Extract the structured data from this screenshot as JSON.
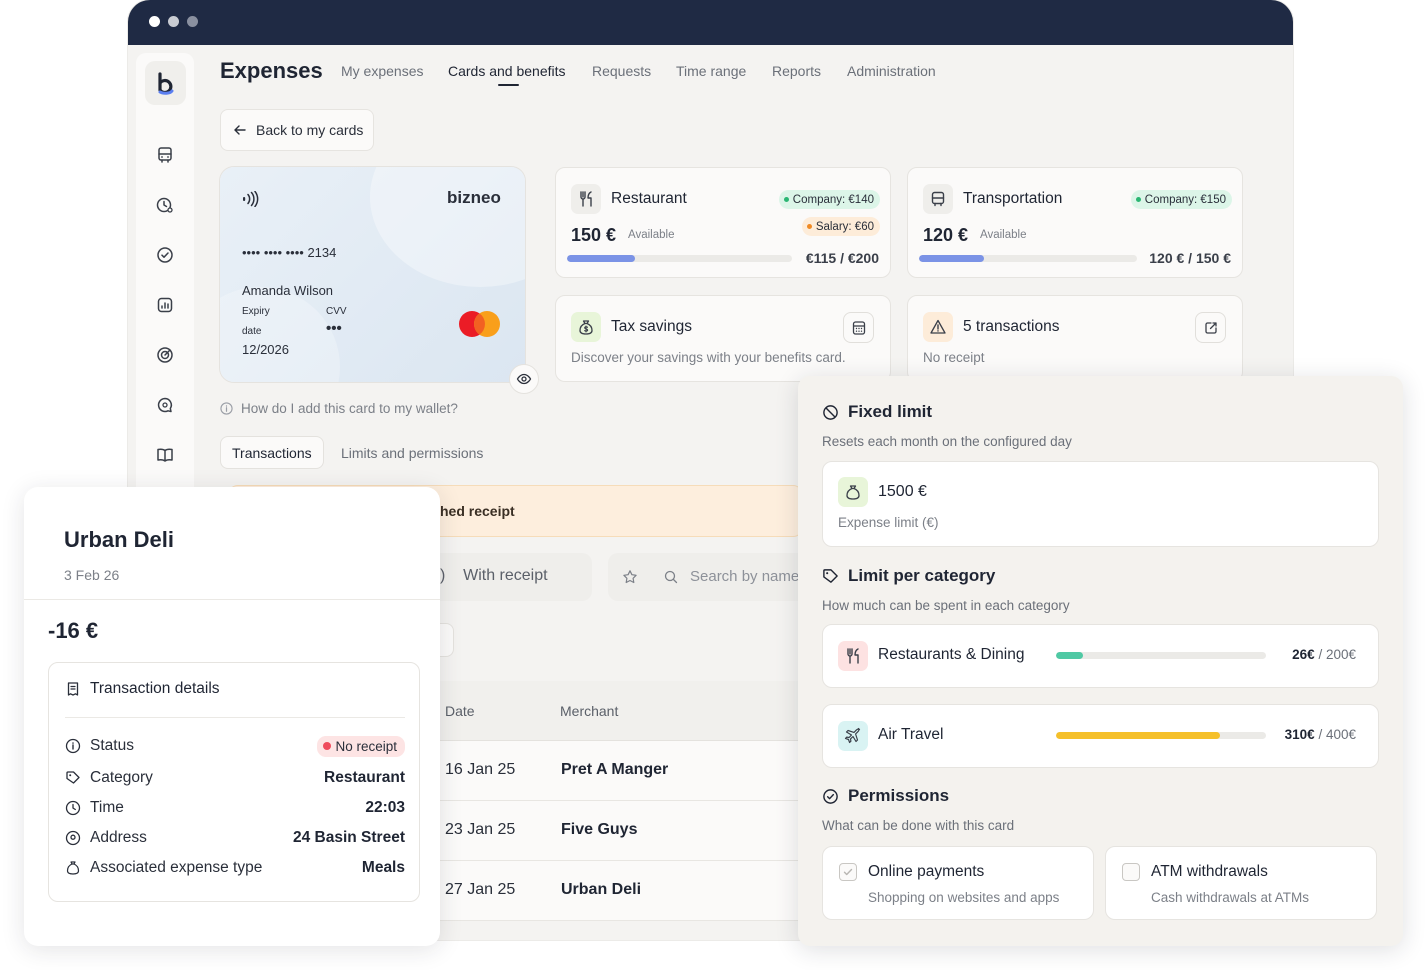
{
  "app": {
    "title": "Expenses",
    "nav_tabs": [
      {
        "label": "My expenses",
        "active": false
      },
      {
        "label": "Cards and benefits",
        "active": true
      },
      {
        "label": "Requests",
        "active": false
      },
      {
        "label": "Time range",
        "active": false
      },
      {
        "label": "Reports",
        "active": false
      },
      {
        "label": "Administration",
        "active": false
      }
    ],
    "back_label": "Back to my cards"
  },
  "card": {
    "brand": "bizneo",
    "number": "•••• •••• •••• 2134",
    "holder": "Amanda Wilson",
    "expiry_label": "Expiry",
    "expiry_label2": "date",
    "expiry_value": "12/2026",
    "cvv_label": "CVV",
    "cvv_value": "•••",
    "wallet_hint": "How do I add this card to my wallet?"
  },
  "sub_tabs": [
    {
      "label": "Transactions",
      "active": true
    },
    {
      "label": "Limits and permissions",
      "active": false
    }
  ],
  "benefits": {
    "restaurant": {
      "title": "Restaurant",
      "badge_company": "Company: €140",
      "badge_salary": "Salary: €60",
      "amount": "150 €",
      "available_label": "Available",
      "ratio": "€115 / €200",
      "progress": 0.3
    },
    "transportation": {
      "title": "Transportation",
      "badge_company": "Company: €150",
      "amount": "120 €",
      "available_label": "Available",
      "ratio": "120 € / 150 €",
      "progress": 0.3
    },
    "tax": {
      "title": "Tax savings",
      "desc": "Discover your savings with your benefits card."
    },
    "transactions": {
      "title": "5 transactions",
      "desc": "No receipt"
    }
  },
  "background": {
    "banner_text": "hed receipt",
    "filter_label": ")    With receipt",
    "search_placeholder": "Search by name",
    "table": {
      "headers": [
        "Date",
        "Merchant"
      ],
      "rows": [
        {
          "date": "16 Jan 25",
          "merchant": "Pret A Manger"
        },
        {
          "date": "23 Jan 25",
          "merchant": "Five Guys"
        },
        {
          "date": "27 Jan 25",
          "merchant": "Urban Deli"
        }
      ]
    }
  },
  "detail": {
    "merchant": "Urban Deli",
    "date": "3 Feb 26",
    "amount": "-16 €",
    "section_title": "Transaction details",
    "rows": {
      "status": {
        "label": "Status",
        "value": "No receipt"
      },
      "category": {
        "label": "Category",
        "value": "Restaurant"
      },
      "time": {
        "label": "Time",
        "value": "22:03"
      },
      "address": {
        "label": "Address",
        "value": "24 Basin Street"
      },
      "expense_type": {
        "label": "Associated expense type",
        "value": "Meals"
      }
    }
  },
  "limits": {
    "fixed": {
      "title": "Fixed limit",
      "subtitle": "Resets each month on the configured day",
      "value": "1500 €",
      "value_label": "Expense limit (€)"
    },
    "category": {
      "title": "Limit per category",
      "subtitle": "How much can be spent in each category",
      "items": [
        {
          "name": "Restaurants & Dining",
          "spent": "26€",
          "limit": "/ 200€",
          "progress": 0.13,
          "color": "#4fc9a4"
        },
        {
          "name": "Air Travel",
          "spent": "310€",
          "limit": "/ 400€",
          "progress": 0.78,
          "color": "#f5c02a"
        }
      ]
    },
    "permissions": {
      "title": "Permissions",
      "subtitle": "What can be done with this card",
      "items": [
        {
          "title": "Online payments",
          "desc": "Shopping on websites and apps",
          "checked": true
        },
        {
          "title": "ATM withdrawals",
          "desc": "Cash withdrawals at ATMs",
          "checked": false
        }
      ]
    }
  },
  "colors": {
    "titlebar": "#1f2a44",
    "progress_blue": "#7b93e6",
    "badge_green_dot": "#2bb673",
    "badge_orange_dot": "#f08a24",
    "status_red": "#ef4b5c"
  }
}
